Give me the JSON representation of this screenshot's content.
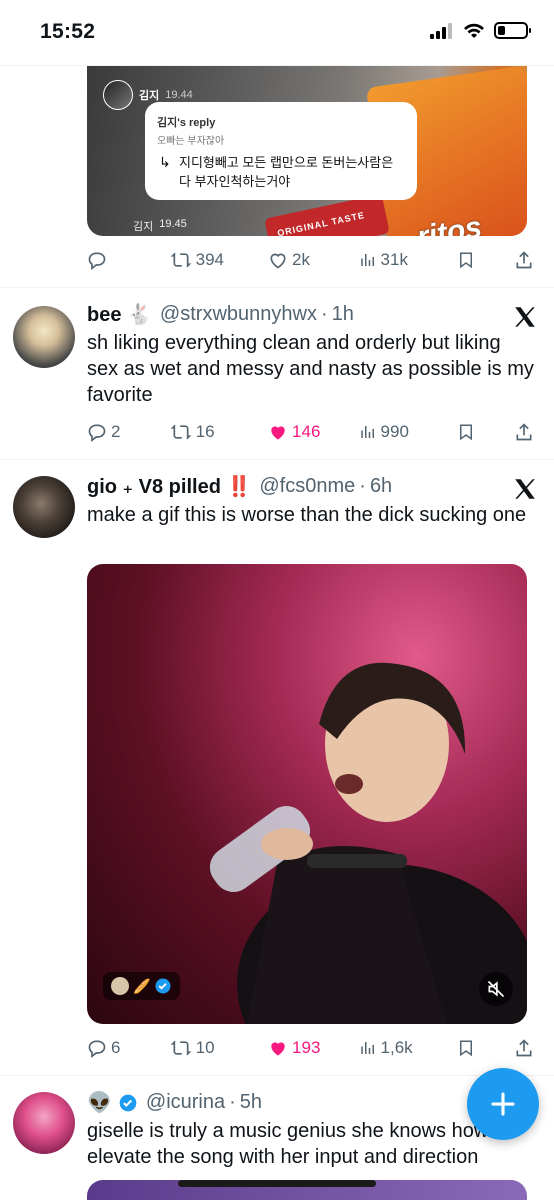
{
  "status_bar": {
    "time": "15:52",
    "battery_level": 0.25
  },
  "tweet1": {
    "embed": {
      "author_name": "김지",
      "author_time": "19.44",
      "reply_title": "김지's reply",
      "reply_sub": "오빠는 부자잖아",
      "reply_arrow": "↳",
      "reply_body": "지디형빼고 모든 랩만으로 돈버는사람은 다 부자인척하는거야",
      "second_author_name": "김지",
      "second_time": "19.45",
      "bag_text": "ORIGINAL TASTE",
      "brand_text": "ritos"
    },
    "actions": {
      "retweets": "394",
      "likes": "2k",
      "views": "31k"
    }
  },
  "tweet2": {
    "display_name": "bee 🐇",
    "handle": "@strxwbunnyhwx",
    "separator": "·",
    "time": "1h",
    "text": "sh liking everything clean and orderly but liking sex as wet and messy and nasty as possible is my favorite",
    "actions": {
      "replies": "2",
      "retweets": "16",
      "likes": "146",
      "views": "990"
    }
  },
  "tweet3": {
    "display_name": "gio ₊ V8 pilled ‼️",
    "handle": "@fcs0nme",
    "separator": "·",
    "time": "6h",
    "text": "make a gif this is worse than the dick sucking one",
    "media_badge": "🥖",
    "actions": {
      "replies": "6",
      "retweets": "10",
      "likes": "193",
      "views": "1,6k"
    }
  },
  "tweet4": {
    "display_name": "👽",
    "handle": "@icurina",
    "separator": "·",
    "time": "5h",
    "text": "giselle is truly a music genius she knows how to elevate the song with her input and direction"
  },
  "colors": {
    "accent": "#1d9bf0",
    "like": "#f91880",
    "muted": "#536471"
  },
  "icons": [
    "signal-icon",
    "wifi-icon",
    "battery-icon",
    "reply-icon",
    "retweet-icon",
    "like-icon",
    "views-icon",
    "bookmark-icon",
    "share-icon",
    "x-logo-icon",
    "verified-icon",
    "mute-icon",
    "plus-icon"
  ]
}
